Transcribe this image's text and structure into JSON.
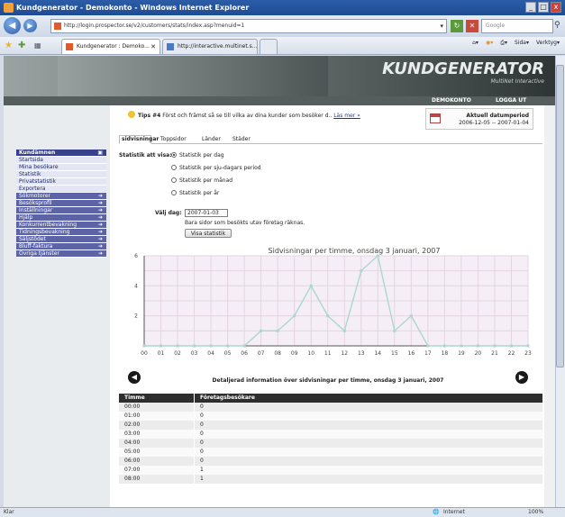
{
  "window": {
    "title": "Kundgenerator - Demokonto - Windows Internet Explorer",
    "controls": [
      "_",
      "□",
      "x"
    ]
  },
  "browser": {
    "address": "http://login.prospector.se/v2/customers/stats/index.asp?menuid=1",
    "search_placeholder": "Google",
    "tabs": [
      {
        "label": "Kundgenerator : Demoko..."
      },
      {
        "label": "http://interactive.multinet.s..."
      }
    ],
    "commands": [
      "Sida",
      "Verktyg"
    ]
  },
  "header": {
    "logo": "KUNDGENERATOR",
    "logo_sub": "MultiNet Interactive",
    "demo": "DEMOKONTO",
    "logout": "LOGGA UT"
  },
  "tip": {
    "prefix": "Tips #4",
    "text": "Först och främst så se till vilka av dina kunder som besöker d..",
    "link": "Läs mer »"
  },
  "period": {
    "label": "Aktuell datumperiod",
    "range": "2006-12-05 -- 2007-01-04"
  },
  "content_tabs": [
    "sidvisningar",
    "Toppsidor",
    "Länder",
    "Städer"
  ],
  "sidebar": {
    "items": [
      {
        "label": "Kundämnen",
        "style": "hdr"
      },
      {
        "label": "Startsida",
        "style": "lt"
      },
      {
        "label": "Mina besökare",
        "style": "lt"
      },
      {
        "label": "Statistik",
        "style": "lt"
      },
      {
        "label": "Privatstatistik",
        "style": "lt"
      },
      {
        "label": "Exportera",
        "style": "lt"
      },
      {
        "label": "Sökmotorer",
        "style": "dk"
      },
      {
        "label": "Besöksprofil",
        "style": "dk"
      },
      {
        "label": "Inställningar",
        "style": "dk"
      },
      {
        "label": "Hjälp",
        "style": "dk"
      },
      {
        "label": "Konkurrentbevakning",
        "style": "dk"
      },
      {
        "label": "Tidningsbevakning",
        "style": "dk"
      },
      {
        "label": "Säljstödet",
        "style": "dk"
      },
      {
        "label": "Bluff-faktura",
        "style": "dk"
      },
      {
        "label": "Övriga tjänster",
        "style": "dk"
      }
    ]
  },
  "form": {
    "stat_label": "Statistik att visa:",
    "options": [
      "Statistik per dag",
      "Statistik per sju-dagars period",
      "Statistik per månad",
      "Statistik per år"
    ],
    "selected": 0,
    "day_label": "Välj dag:",
    "day_value": "2007-01-03",
    "note": "Bara sidor som besökts utav företag räknas.",
    "button": "Visa statistik"
  },
  "chart_data": {
    "type": "line",
    "title": "Sidvisningar per timme, onsdag 3 januari, 2007",
    "x": [
      "00",
      "01",
      "02",
      "03",
      "04",
      "05",
      "06",
      "07",
      "08",
      "09",
      "10",
      "11",
      "12",
      "13",
      "14",
      "15",
      "16",
      "17",
      "18",
      "19",
      "20",
      "21",
      "22",
      "23"
    ],
    "values": [
      0,
      0,
      0,
      0,
      0,
      0,
      0,
      1,
      1,
      2,
      4,
      2,
      1,
      5,
      6,
      1,
      2,
      0,
      0,
      0,
      0,
      0,
      0,
      0
    ],
    "ylim": [
      0,
      6
    ],
    "yticks": [
      "2",
      "4",
      "6"
    ],
    "grid": true,
    "color": "#a9d8cf"
  },
  "detail": {
    "title": "Detaljerad information över sidvisningar per timme, onsdag 3 januari, 2007",
    "headers": [
      "Timme",
      "Företagsbesökare"
    ],
    "rows": [
      [
        "00:00",
        "0"
      ],
      [
        "01:00",
        "0"
      ],
      [
        "02:00",
        "0"
      ],
      [
        "03:00",
        "0"
      ],
      [
        "04:00",
        "0"
      ],
      [
        "05:00",
        "0"
      ],
      [
        "06:00",
        "0"
      ],
      [
        "07:00",
        "1"
      ],
      [
        "08:00",
        "1"
      ]
    ]
  },
  "status": {
    "left": "Klar",
    "zone": "Internet",
    "zoom": "100%"
  }
}
